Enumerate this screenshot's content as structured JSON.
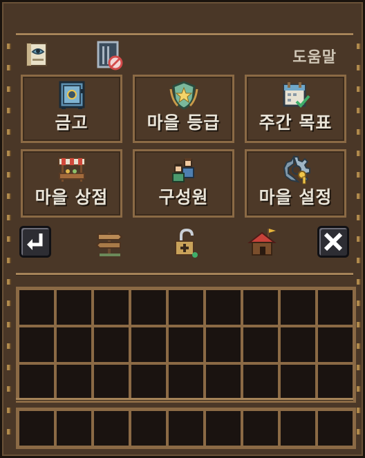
{
  "header": {
    "help_label": "도움말"
  },
  "menu": [
    {
      "label": "금고",
      "icon": "safe-icon"
    },
    {
      "label": "마을 등급",
      "icon": "shield-badge-icon"
    },
    {
      "label": "주간 목표",
      "icon": "calendar-check-icon"
    },
    {
      "label": "마을 상점",
      "icon": "shop-stall-icon"
    },
    {
      "label": "구성원",
      "icon": "members-icon"
    },
    {
      "label": "마을 설정",
      "icon": "gear-key-icon"
    }
  ],
  "toolbar": {
    "back": "back-arrow-icon",
    "sign": "signpost-icon",
    "lock": "padlock-icon",
    "home": "house-flag-icon",
    "close": "close-icon"
  },
  "inventory": {
    "rows_main": 3,
    "rows_hotbar": 1,
    "cols": 9
  },
  "colors": {
    "panel": "#4a3727",
    "border": "#8b6a45",
    "slot": "#1a1310",
    "text": "#e9e4d8"
  }
}
